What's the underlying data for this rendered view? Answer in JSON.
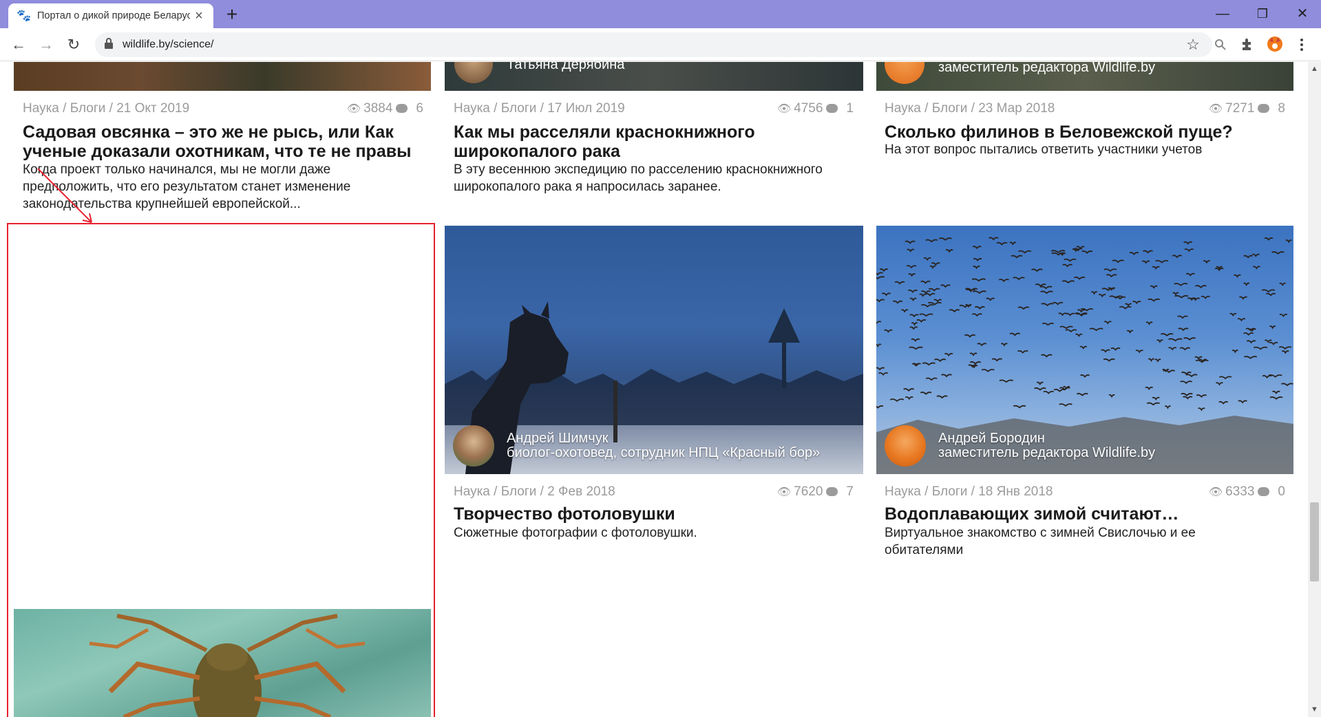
{
  "browser": {
    "tab_title": "Портал о дикой природе Беларуси",
    "tab_close": "×",
    "new_tab": "+",
    "url": "wildlife.by/science/",
    "controls": {
      "minimize": "—",
      "restore": "❐",
      "close": "✕"
    },
    "nav": {
      "back": "←",
      "forward": "→",
      "reload": "↻"
    },
    "bookmark_star": "☆"
  },
  "page": {
    "articles": [
      {
        "meta": "Наука / Блоги / 21 Окт 2019",
        "views": "3884",
        "comments": "6",
        "title": "Садовая овсянка – это же не рысь, или Как ученые доказали охотникам, что те не правы",
        "excerpt": "Когда проект только начинался, мы не могли даже предположить, что его результатом станет изменение законодательства крупнейшей европейской..."
      },
      {
        "author_name": "Татьяна Дерябина",
        "meta": "Наука / Блоги / 17 Июл 2019",
        "views": "4756",
        "comments": "1",
        "title": "Как мы расселяли краснокнижного широкопалого рака",
        "excerpt": "В эту весеннюю экспедицию по расселению краснокнижного широкопалого рака я напросилась заранее."
      },
      {
        "author_role": "заместитель редактора Wildlife.by",
        "meta": "Наука / Блоги / 23 Мар 2018",
        "views": "7271",
        "comments": "8",
        "title": "Сколько филинов в Беловежской пуще?",
        "excerpt": "На этот вопрос пытались ответить участники учетов"
      },
      {
        "author_name": "Андрей Шимчук",
        "author_role": "биолог-охотовед, сотрудник НПЦ «Красный бор»",
        "meta": "Наука / Блоги / 2 Фев 2018",
        "views": "7620",
        "comments": "7",
        "title": "Творчество фотоловушки",
        "excerpt": "Сюжетные фотографии с фотоловушки."
      },
      {
        "author_name": "Андрей Бородин",
        "author_role": "заместитель редактора Wildlife.by",
        "meta": "Наука / Блоги / 18 Янв 2018",
        "views": "6333",
        "comments": "0",
        "title": "Водоплавающих зимой считают…",
        "excerpt": "Виртуальное знакомство с зимней Свислочью и ее обитателями"
      }
    ]
  },
  "colors": {
    "titlebar": "#8f8ddc",
    "annotation": "#e8202e",
    "meta_text": "#9b9b9b"
  },
  "icons": [
    "paw-icon",
    "lock-icon",
    "star-icon",
    "search-icon",
    "puzzle-icon",
    "fox-avatar-icon",
    "menu-icon",
    "eye-icon",
    "comment-icon"
  ]
}
